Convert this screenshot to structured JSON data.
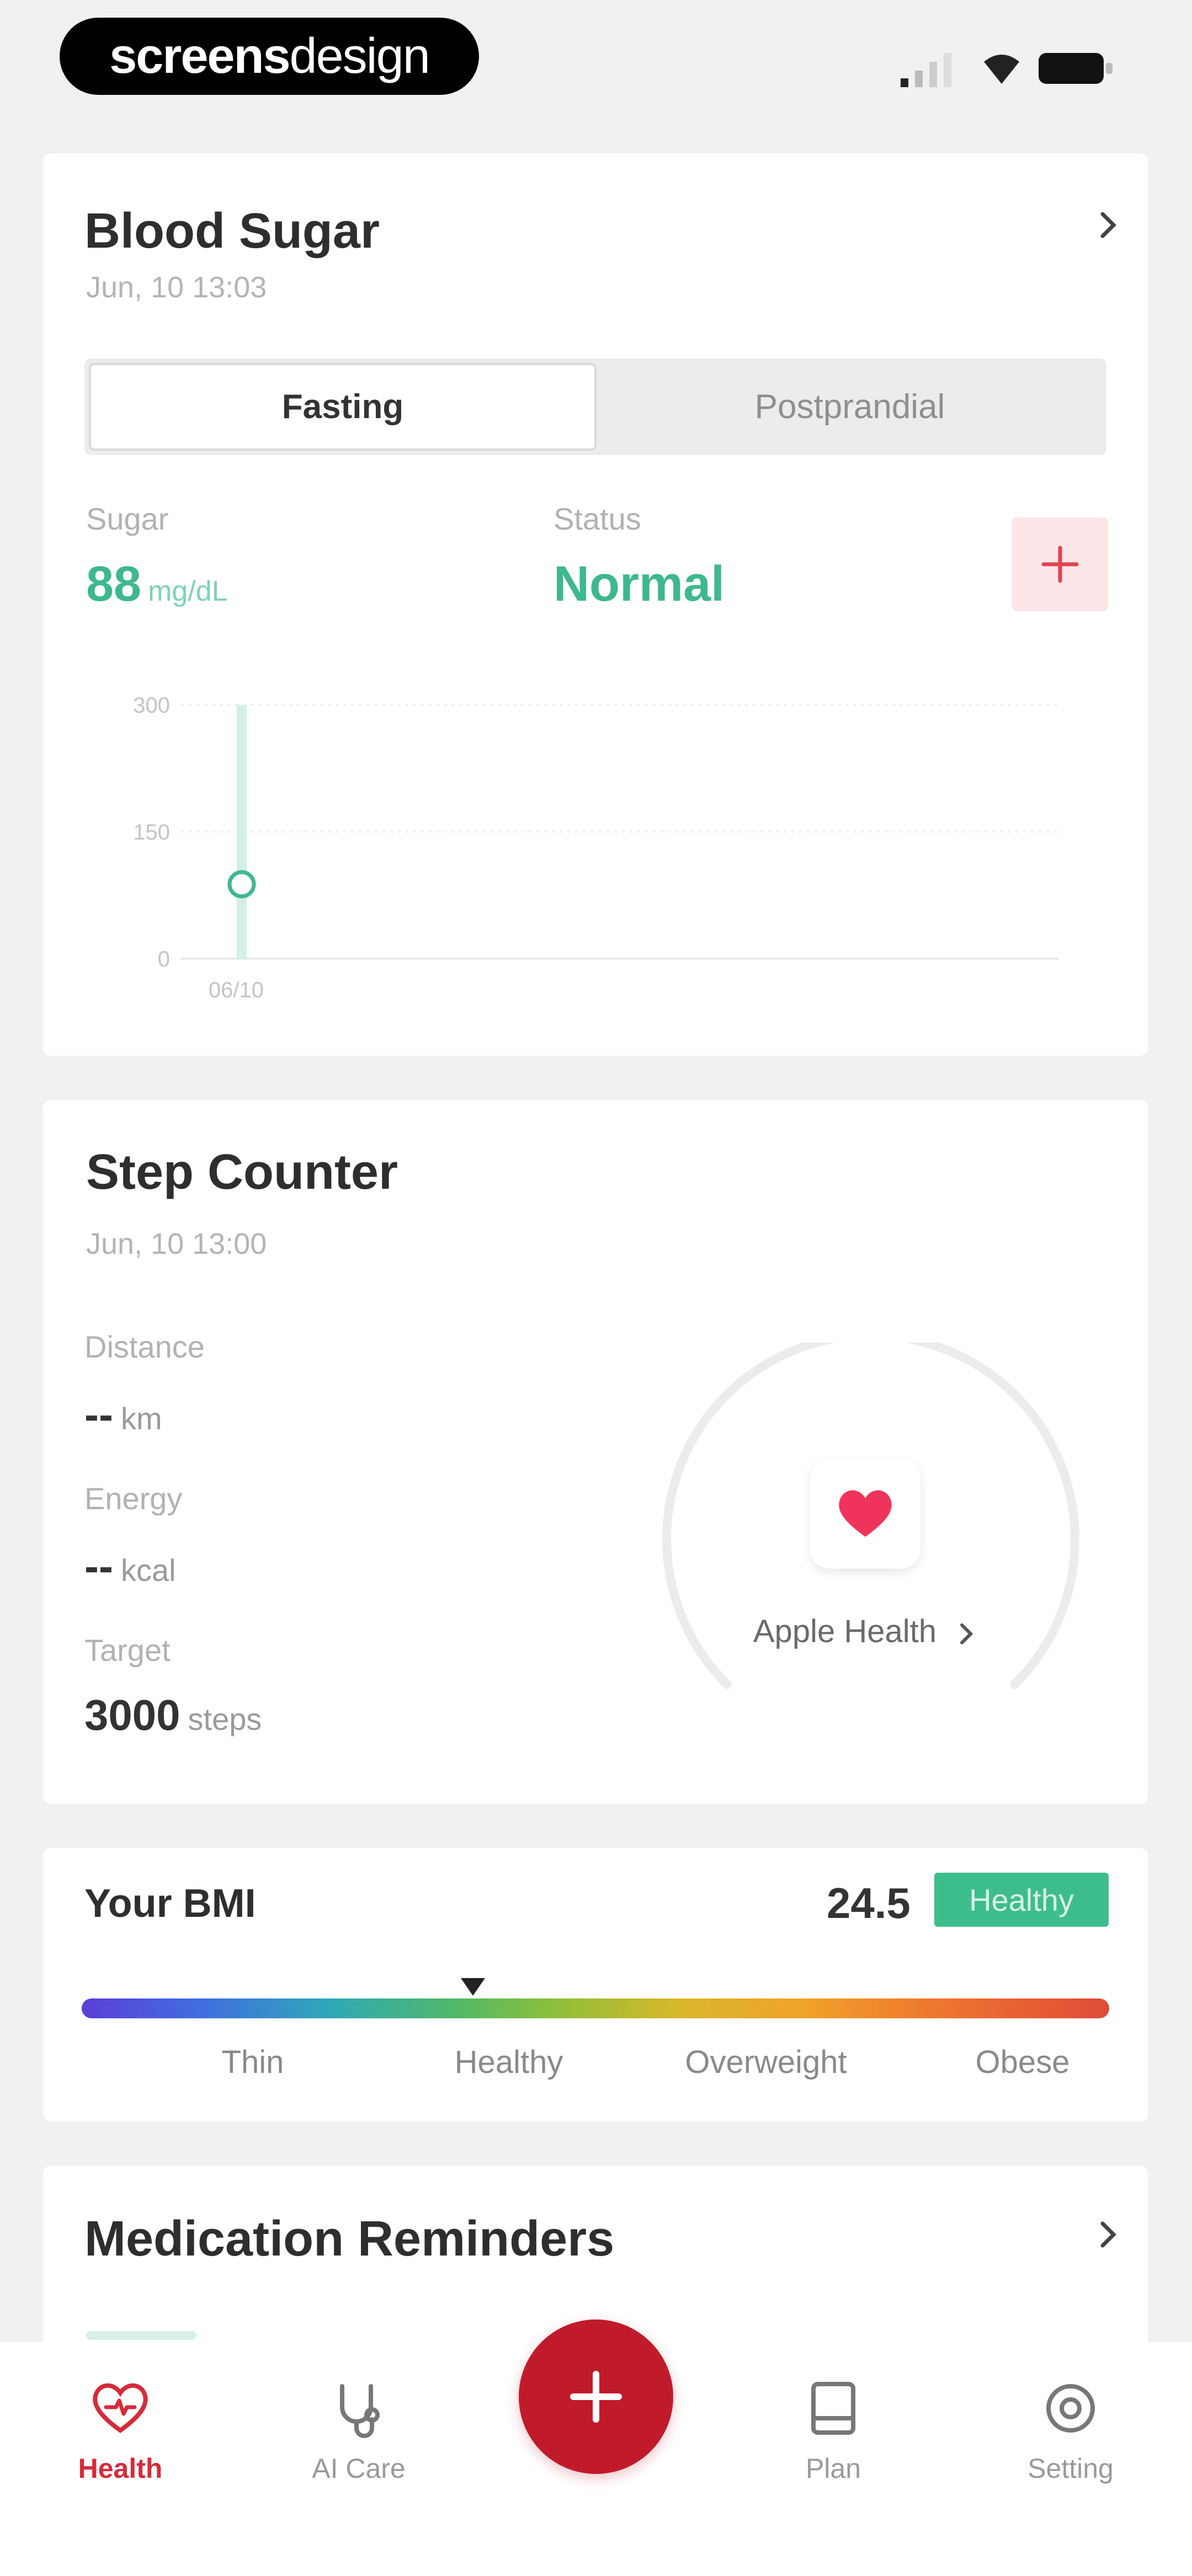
{
  "status_bar": {
    "brand_bold": "screens",
    "brand_light": "design"
  },
  "blood_sugar": {
    "title": "Blood Sugar",
    "date": "Jun, 10 13:03",
    "tabs": [
      "Fasting",
      "Postprandial"
    ],
    "active_tab": "Fasting",
    "sugar_label": "Sugar",
    "sugar_value": "88",
    "sugar_unit": "mg/dL",
    "status_label": "Status",
    "status_value": "Normal",
    "chart_data": {
      "type": "scatter",
      "title": "",
      "xlabel": "",
      "ylabel": "",
      "categories": [
        "06/10"
      ],
      "values": [
        88
      ],
      "ylim": [
        0,
        300
      ],
      "y_ticks": [
        "300",
        "150",
        "0"
      ],
      "grid": true,
      "color": "#3eb88d"
    }
  },
  "step_counter": {
    "title": "Step Counter",
    "date": "Jun, 10 13:00",
    "distance_label": "Distance",
    "distance_value": "--",
    "distance_unit": "km",
    "energy_label": "Energy",
    "energy_value": "--",
    "energy_unit": "kcal",
    "target_label": "Target",
    "target_value": "3000",
    "target_unit": "steps",
    "apple_health_label": "Apple Health"
  },
  "bmi": {
    "title": "Your BMI",
    "value": "24.5",
    "badge": "Healthy",
    "categories": [
      "Thin",
      "Healthy",
      "Overweight",
      "Obese"
    ]
  },
  "medication": {
    "title": "Medication Reminders"
  },
  "nav": {
    "items": [
      {
        "label": "Health",
        "icon": "heart-icon",
        "active": true
      },
      {
        "label": "AI Care",
        "icon": "stethoscope-icon",
        "active": false
      },
      {
        "label": "Plan",
        "icon": "plan-icon",
        "active": false
      },
      {
        "label": "Setting",
        "icon": "gear-icon",
        "active": false
      }
    ]
  },
  "colors": {
    "accent_red": "#c11b2b",
    "green": "#3eb88d",
    "background": "#f1f1f3"
  }
}
